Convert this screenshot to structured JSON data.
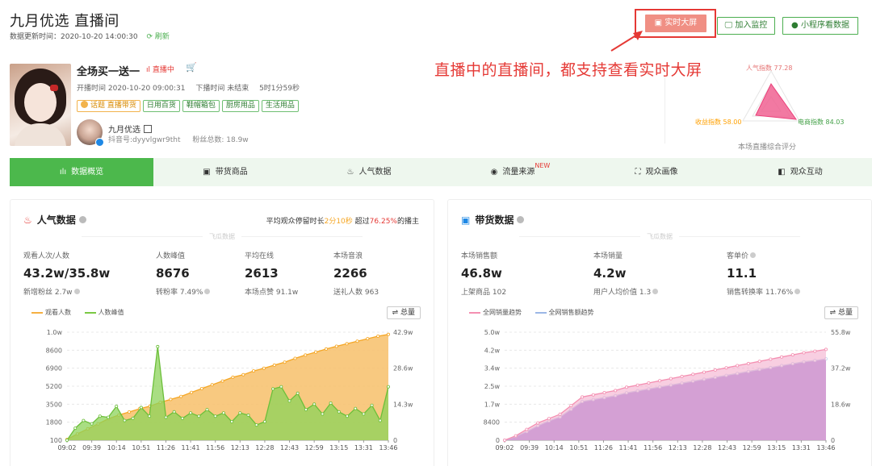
{
  "header": {
    "title": "九月优选  直播间",
    "updated_label": "数据更新时间：2020-10-20 14:00:30",
    "refresh_label": "刷新",
    "btn_bigscreen": "实时大屏",
    "btn_monitor": "加入监控",
    "btn_miniapp": "小程序看数据"
  },
  "annotation": "直播中的直播间，都支持查看实时大屏",
  "broadcast": {
    "name": "全场买一送一",
    "status": "直播中",
    "start": "开播时间 2020-10-20 09:00:31",
    "end": "下播时间 未结束",
    "duration": "5时1分59秒",
    "tags": [
      "话题 直播带货",
      "日用百货",
      "鞋帽箱包",
      "厨房用品",
      "生活用品"
    ],
    "anchor_name": "九月优选",
    "anchor_id": "抖音号:dyyvlgwr9tht",
    "fans": "粉丝总数: 18.9w"
  },
  "radar": {
    "popularity": "人气指数 77.28",
    "sales": "收益指数 58.00",
    "ecommerce": "电商指数 84.03",
    "caption": "本场直播综合评分"
  },
  "tabs": [
    {
      "label": "数据概览",
      "icon": "bar-chart-icon"
    },
    {
      "label": "带货商品",
      "icon": "shopping-bag-icon"
    },
    {
      "label": "人气数据",
      "icon": "flame-icon"
    },
    {
      "label": "流量来源",
      "icon": "compass-icon",
      "badge": "NEW"
    },
    {
      "label": "观众画像",
      "icon": "portrait-icon"
    },
    {
      "label": "观众互动",
      "icon": "interaction-icon"
    }
  ],
  "popularity": {
    "title": "人气数据",
    "extra_pre": "平均观众停留时长",
    "extra_time": "2分10秒",
    "extra_mid": " 超过",
    "extra_pct": "76.25%",
    "extra_post": "的播主",
    "watermark": "飞瓜数据",
    "stats": [
      {
        "label": "观看人次/人数",
        "value": "43.2w/35.8w",
        "sub": "新增粉丝 2.7w"
      },
      {
        "label": "人数峰值",
        "value": "8676",
        "sub": "转粉率 7.49%"
      },
      {
        "label": "平均在线",
        "value": "2613",
        "sub": "本场点赞 91.1w"
      },
      {
        "label": "本场音浪",
        "value": "2266",
        "sub": "送礼人数 963"
      }
    ],
    "legend": [
      "观看人数",
      "人数峰值"
    ],
    "total_label": "总量"
  },
  "sales": {
    "title": "带货数据",
    "watermark": "飞瓜数据",
    "stats": [
      {
        "label": "本场销售额",
        "value": "46.8w",
        "sub": "上架商品 102"
      },
      {
        "label": "本场销量",
        "value": "4.2w",
        "sub": "用户人均价值 1.3"
      },
      {
        "label": "客单价",
        "value": "11.1",
        "sub": "销售转换率 11.76%"
      }
    ],
    "legend": [
      "全网销量趋势",
      "全网销售额趋势"
    ],
    "total_label": "总量"
  },
  "chart_data": [
    {
      "type": "area",
      "title": "人气数据",
      "x": [
        "09:02",
        "09:39",
        "10:14",
        "10:51",
        "11:26",
        "11:41",
        "11:56",
        "12:13",
        "12:28",
        "12:43",
        "12:59",
        "13:15",
        "13:31",
        "13:46"
      ],
      "y_left_ticks": [
        "100",
        "1800",
        "3500",
        "5200",
        "6900",
        "8600",
        "1.0w"
      ],
      "y_right_ticks": [
        "0",
        "14.3w",
        "28.6w",
        "42.9w"
      ],
      "series": [
        {
          "name": "观看人数",
          "axis": "right",
          "color": "#f5b041",
          "values": [
            0.3,
            2.5,
            4.5,
            6.5,
            8.5,
            10.0,
            11.2,
            12.5,
            13.5,
            15.0,
            16.2,
            17.4,
            19.0,
            20.5,
            22.0,
            23.5,
            25.0,
            26.0,
            27.5,
            28.6,
            29.8,
            31.0,
            32.5,
            33.8,
            35.0,
            36.2,
            37.3,
            38.3,
            39.3,
            40.3,
            41.3,
            42.0
          ]
        },
        {
          "name": "人数峰值",
          "axis": "left",
          "color": "#7ac943",
          "values": [
            100,
            1200,
            1900,
            1600,
            2300,
            2200,
            3200,
            1900,
            2100,
            3100,
            2300,
            8676,
            2200,
            2700,
            2100,
            2600,
            2300,
            2900,
            2300,
            2600,
            1800,
            2600,
            2400,
            1500,
            1800,
            4800,
            5000,
            3700,
            4400,
            2900,
            3400,
            2500,
            3500,
            2700,
            2300,
            3000,
            2500,
            3300,
            1900,
            5000
          ]
        }
      ]
    },
    {
      "type": "area",
      "title": "带货数据",
      "x": [
        "09:02",
        "09:39",
        "10:14",
        "10:51",
        "11:26",
        "11:41",
        "11:56",
        "12:13",
        "12:28",
        "12:43",
        "12:59",
        "13:15",
        "13:31",
        "13:46"
      ],
      "y_left_ticks": [
        "0",
        "8400",
        "1.7w",
        "2.5w",
        "3.4w",
        "4.2w",
        "5.0w"
      ],
      "y_right_ticks": [
        "0",
        "18.6w",
        "37.2w",
        "55.8w"
      ],
      "series": [
        {
          "name": "全网销量趋势",
          "axis": "left",
          "color": "#f48fb1",
          "values": [
            0,
            0.2,
            0.5,
            0.8,
            1.0,
            1.2,
            1.6,
            2.0,
            2.1,
            2.2,
            2.3,
            2.45,
            2.55,
            2.65,
            2.75,
            2.85,
            2.95,
            3.05,
            3.15,
            3.25,
            3.35,
            3.45,
            3.55,
            3.65,
            3.75,
            3.85,
            3.95,
            4.05,
            4.12,
            4.2
          ]
        },
        {
          "name": "全网销售额趋势",
          "axis": "right",
          "color": "#9b8fe0",
          "values": [
            0,
            2.0,
            4.5,
            7.5,
            10.0,
            12.0,
            16.0,
            20.0,
            21.0,
            22.0,
            23.0,
            24.5,
            25.5,
            26.5,
            27.5,
            28.5,
            29.5,
            30.5,
            31.5,
            32.5,
            33.5,
            34.5,
            35.5,
            36.5,
            37.5,
            38.5,
            39.5,
            40.5,
            41.2,
            42.0
          ]
        }
      ]
    }
  ]
}
